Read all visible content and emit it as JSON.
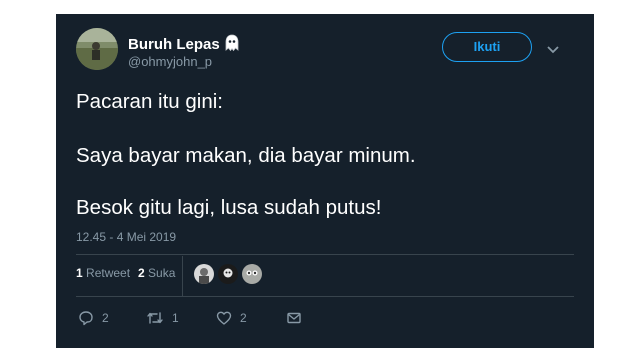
{
  "author": {
    "display_name": "Buruh Lepas",
    "badge_icon": "ghost-icon",
    "handle": "@ohmyjohn_p"
  },
  "follow_label": "Ikuti",
  "tweet_lines": [
    "Pacaran itu gini:",
    "Saya bayar makan, dia bayar minum.",
    "Besok gitu lagi, lusa sudah putus!"
  ],
  "timestamp": "12.45 - 4 Mei 2019",
  "stats": {
    "retweet_count": "1",
    "retweet_label": "Retweet",
    "like_count": "2",
    "like_label": "Suka"
  },
  "actions": {
    "reply_count": "2",
    "retweet_count": "1",
    "like_count": "2"
  },
  "colors": {
    "background": "#15202b",
    "accent": "#1da1f2",
    "secondary_text": "#8899a6",
    "divider": "#38444d"
  }
}
